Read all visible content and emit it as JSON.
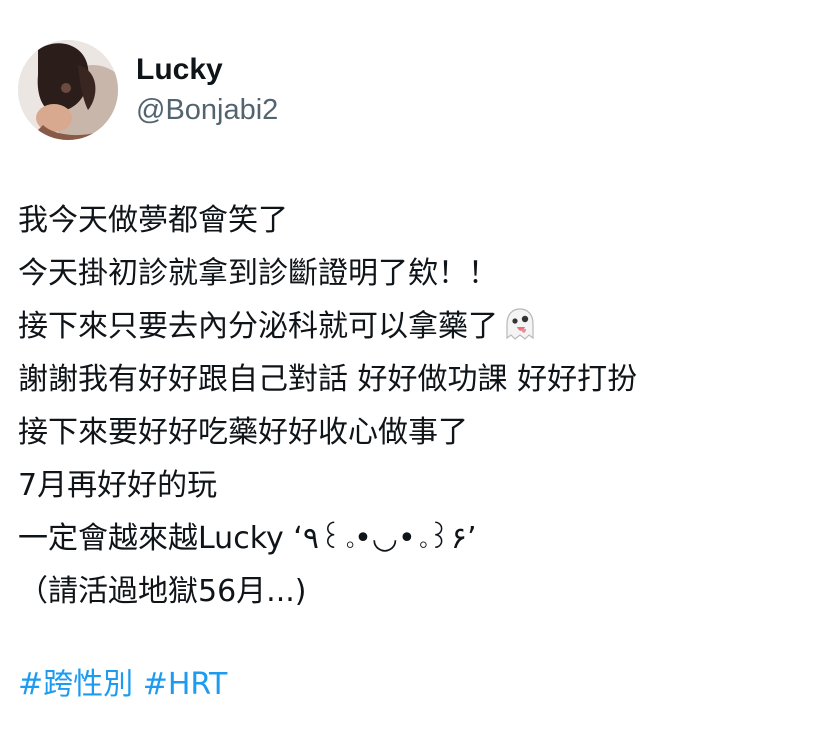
{
  "author": {
    "display_name": "Lucky",
    "handle": "@Bonjabi2",
    "avatar_icon": "user-avatar-photo"
  },
  "tweet": {
    "lines": [
      "我今天做夢都會笑了",
      "今天掛初診就拿到診斷證明了欸！！",
      "接下來只要去內分泌科就可以拿藥了",
      "謝謝我有好好跟自己對話 好好做功課 好好打扮",
      "接下來要好好吃藥好好收心做事了",
      "7月再好好的玩",
      "一定會越來越Lucky ‘٩꒰｡•◡•｡꒱۶’",
      "（請活過地獄56月...)"
    ],
    "emoji_after_line_3": "ghost-emoji",
    "hashtags": [
      "#跨性別",
      "#HRT"
    ]
  },
  "colors": {
    "text": "#0f1419",
    "secondary": "#536471",
    "link": "#1d9bf0"
  }
}
